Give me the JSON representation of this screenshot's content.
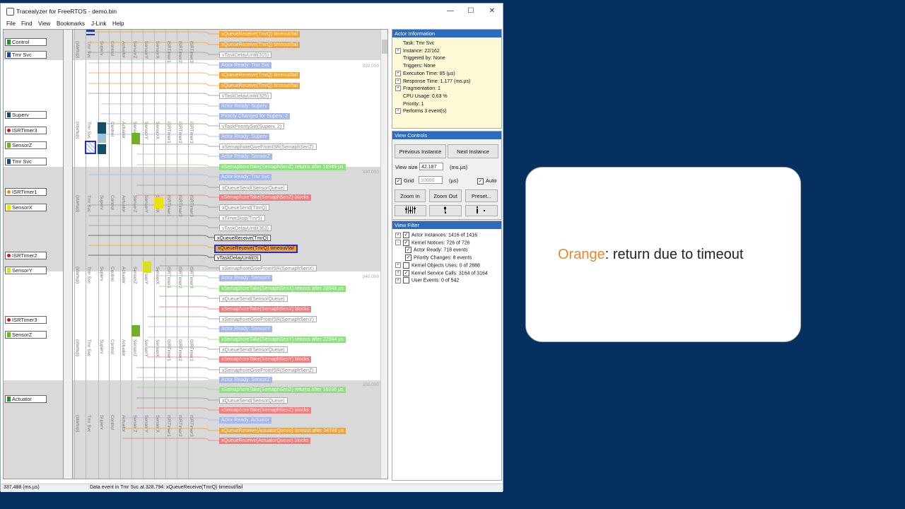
{
  "window": {
    "title": "Tracealyzer for FreeRTOS - demo.bin",
    "controls": {
      "minimize": "—",
      "maximize": "☐",
      "close": "✕"
    }
  },
  "menu": [
    "File",
    "Find",
    "View",
    "Bookmarks",
    "J-Link",
    "Help"
  ],
  "timeline": {
    "lane_headers": [
      "(startup)",
      "Tmr Svc",
      "Superv",
      "Control",
      "Actuator",
      "SensorZ",
      "SensorY",
      "SensorX",
      "ISRTimer1",
      "ISRTimer2",
      "ISRTimer3"
    ],
    "actors": [
      {
        "label": "Control",
        "color": "#2e8b2e",
        "kind": "square"
      },
      {
        "label": "Tmr Svc",
        "color": "#1f3fa8",
        "kind": "square"
      },
      {
        "label": "Superv",
        "color": "#124d6b",
        "kind": "square"
      },
      {
        "label": "ISRTimer3",
        "color": "#d01818",
        "kind": "dot"
      },
      {
        "label": "SensorZ",
        "color": "#6db12a",
        "kind": "square"
      },
      {
        "label": "Tmr Svc",
        "color": "#1f3fa8",
        "kind": "square"
      },
      {
        "label": "ISRTimer1",
        "color": "#f08a1a",
        "kind": "dot"
      },
      {
        "label": "SensorX",
        "color": "#f2de10",
        "kind": "square"
      },
      {
        "label": "ISRTimer2",
        "color": "#d01818",
        "kind": "dot"
      },
      {
        "label": "SensorY",
        "color": "#d7e21a",
        "kind": "square"
      },
      {
        "label": "ISRTimer3",
        "color": "#d01818",
        "kind": "dot"
      },
      {
        "label": "SensorZ",
        "color": "#6db12a",
        "kind": "square"
      },
      {
        "label": "Actuator",
        "color": "#2e8b2e",
        "kind": "square"
      }
    ],
    "timestamps": [
      "320.000",
      "330.000",
      "340.000",
      "350.000"
    ],
    "events": [
      {
        "text": "xQueueReceive(TmrQ) timeout/fail",
        "kind": "orange"
      },
      {
        "text": "xQueueReceive(TmrQ) timeout/fail",
        "kind": "orange"
      },
      {
        "text": "vTaskDelayUntil(315)",
        "kind": "normal"
      },
      {
        "text": "Actor Ready: Tmr Svc",
        "kind": "blue"
      },
      {
        "text": "xQueueReceive(TmrQ) timeout/fail",
        "kind": "orange"
      },
      {
        "text": "xQueueReceive(TmrQ) timeout/fail",
        "kind": "orange"
      },
      {
        "text": "vTaskDelayUntil(325)",
        "kind": "normal"
      },
      {
        "text": "Actor Ready: Superv",
        "kind": "blue"
      },
      {
        "text": "Priority Changed for Superv: 2",
        "kind": "blue"
      },
      {
        "text": "vTaskPrioritySet(Superv, 2)",
        "kind": "normal"
      },
      {
        "text": "Actor Ready: Superv",
        "kind": "blue"
      },
      {
        "text": "xSemaphoreGiveFromISR(SemaphSenZ)",
        "kind": "normal"
      },
      {
        "text": "Actor Ready: SensorZ",
        "kind": "blue"
      },
      {
        "text": "xSemaphoreTake(SemaphSenZ) returns after 16949 µs",
        "kind": "green"
      },
      {
        "text": "Actor Ready: Tmr Svc",
        "kind": "blue"
      },
      {
        "text": "xQueueSend(SensorQueue)",
        "kind": "normal"
      },
      {
        "text": "xSemaphoreTake(SemaphSenZ) blocks",
        "kind": "red"
      },
      {
        "text": "xQueueSend(TmrQ)",
        "kind": "normal"
      },
      {
        "text": "xTimerStop(Tmr5)",
        "kind": "normal"
      },
      {
        "text": "vTaskDelayUntil(363)",
        "kind": "normal"
      },
      {
        "text": "xQueueReceive(TmrQ)",
        "kind": "hl"
      },
      {
        "text": "xQueueReceive(TmrQ) timeout/fail",
        "kind": "hlorange"
      },
      {
        "text": "vTaskDelayUntil(0)",
        "kind": "hl"
      },
      {
        "text": "xSemaphoreGiveFromISR(SemaphSenX)",
        "kind": "normal"
      },
      {
        "text": "Actor Ready: SensorX",
        "kind": "blue"
      },
      {
        "text": "xSemaphoreTake(SemaphSenX) returns after 28948 µs",
        "kind": "green"
      },
      {
        "text": "xQueueSend(SensorQueue)",
        "kind": "normal"
      },
      {
        "text": "xSemaphoreTake(SemaphSenX) blocks",
        "kind": "red"
      },
      {
        "text": "xSemaphoreGiveFromISR(SemaphSenY)",
        "kind": "normal"
      },
      {
        "text": "Actor Ready: SensorY",
        "kind": "blue"
      },
      {
        "text": "xSemaphoreTake(SemaphSenY) returns after 22944 µs",
        "kind": "green"
      },
      {
        "text": "xQueueSend(SensorQueue)",
        "kind": "normal"
      },
      {
        "text": "xSemaphoreTake(SemaphSenY) blocks",
        "kind": "red"
      },
      {
        "text": "xSemaphoreGiveFromISR(SemaphSenZ)",
        "kind": "normal"
      },
      {
        "text": "Actor Ready: SensorZ",
        "kind": "blue"
      },
      {
        "text": "xSemaphoreTake(SemaphSenZ) returns after 16938 µs",
        "kind": "green"
      },
      {
        "text": "xQueueSend(SensorQueue)",
        "kind": "normal"
      },
      {
        "text": "xSemaphoreTake(SemaphSenZ) blocks",
        "kind": "red"
      },
      {
        "text": "Actor Ready: Actuator",
        "kind": "blue"
      },
      {
        "text": "xQueueReceive(ActuatorQueue) timeout after 34748 µs",
        "kind": "orange"
      },
      {
        "text": "xQueueReceive(ActuatorQueue) blocks",
        "kind": "red"
      }
    ]
  },
  "actor_info": {
    "header": "Actor Information",
    "rows": [
      {
        "text": "Task: Tmr Svc",
        "expander": ""
      },
      {
        "text": "Instance: 22/162",
        "expander": "+"
      },
      {
        "text": "Triggered by: None",
        "expander": ""
      },
      {
        "text": "Triggers: None",
        "expander": ""
      },
      {
        "text": "Execution Time: 85 (µs)",
        "expander": "+"
      },
      {
        "text": "Response Time: 1.177 (ms.µs)",
        "expander": "+"
      },
      {
        "text": "Fragmentation: 1",
        "expander": "+"
      },
      {
        "text": "CPU Usage: 0.63 %",
        "expander": ""
      },
      {
        "text": "Priority: 1",
        "expander": ""
      },
      {
        "text": "Performs 3 event(s)",
        "expander": "+"
      }
    ]
  },
  "view_controls": {
    "header": "View Controls",
    "prev_instance": "Previous Instance",
    "next_instance": "Next Instance",
    "view_size_label": "View size",
    "view_size_value": "42.187",
    "view_size_unit": "(ms.µs)",
    "grid_label": "Grid",
    "grid_value": "10000",
    "grid_unit": "(µs)",
    "auto_label": "Auto",
    "zoom_in": "Zoom In",
    "zoom_out": "Zoom Out",
    "preset": "Preset..."
  },
  "view_filter": {
    "header": "View Filter",
    "items": [
      {
        "text": "Actor Instances: 1416 of 1416",
        "expander": "+",
        "checked": true,
        "indent": 0
      },
      {
        "text": "Kernel Notices: 726 of 726",
        "expander": "−",
        "checked": true,
        "indent": 0
      },
      {
        "text": "Actor Ready: 718 events",
        "expander": "",
        "checked": true,
        "indent": 1
      },
      {
        "text": "Priority Changes: 8 events",
        "expander": "",
        "checked": true,
        "indent": 1
      },
      {
        "text": "Kernel Objects Uses: 0 of 2888",
        "expander": "+",
        "checked": false,
        "indent": 0
      },
      {
        "text": "Kernel Service Calls: 3164 of 3164",
        "expander": "+",
        "checked": true,
        "indent": 0
      },
      {
        "text": "User Events: 0 of 542",
        "expander": "+",
        "checked": false,
        "indent": 0
      }
    ]
  },
  "status": {
    "left": "337.488 (ms.µs)",
    "message": "Data event in Tmr Svc at 328.794: xQueueReceive(TmrQ) timeout/fail"
  },
  "callout": {
    "highlight": "Orange",
    "rest": ": return due to timeout"
  }
}
